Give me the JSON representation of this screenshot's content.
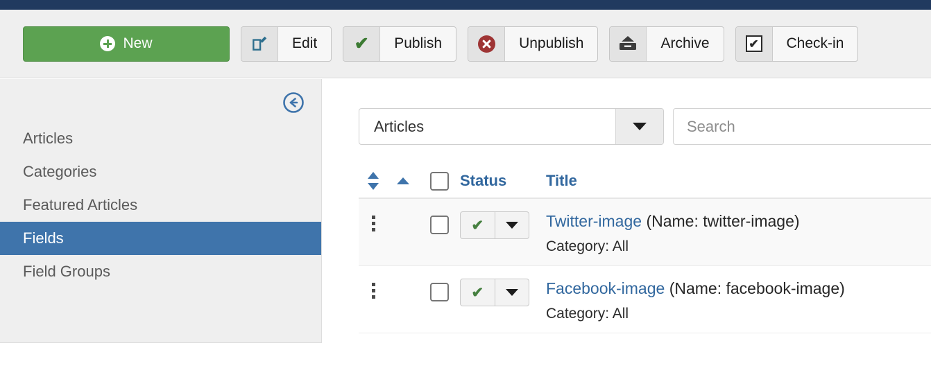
{
  "colors": {
    "topbar": "#213a5f",
    "new_button": "#5ca251",
    "active_menu": "#3f74ab",
    "link": "#31679e",
    "danger": "#9e3434",
    "success": "#468040"
  },
  "toolbar": {
    "buttons": [
      {
        "label": "New",
        "icon": "plus-circle-icon"
      },
      {
        "label": "Edit",
        "icon": "pencil-square-icon"
      },
      {
        "label": "Publish",
        "icon": "check-icon"
      },
      {
        "label": "Unpublish",
        "icon": "x-circle-icon"
      },
      {
        "label": "Archive",
        "icon": "archive-box-icon"
      },
      {
        "label": "Check-in",
        "icon": "checkbox-checked-icon"
      }
    ]
  },
  "sidebar": {
    "collapse_icon": "circle-arrow-left-icon",
    "items": [
      {
        "label": "Articles",
        "active": false
      },
      {
        "label": "Categories",
        "active": false
      },
      {
        "label": "Featured Articles",
        "active": false
      },
      {
        "label": "Fields",
        "active": true
      },
      {
        "label": "Field Groups",
        "active": false
      }
    ]
  },
  "filters": {
    "context_select": {
      "value": "Articles",
      "caret_icon": "chevron-down-icon"
    },
    "search": {
      "value": "",
      "placeholder": "Search"
    }
  },
  "table": {
    "headers": {
      "sort_icon": "sort-updown-icon",
      "ordering_icon": "sort-ascending-icon",
      "select_all": "select-all-checkbox",
      "status": "Status",
      "title": "Title"
    },
    "rows": [
      {
        "grip": "drag-handle-icon",
        "checked": false,
        "status": {
          "icon": "check-icon",
          "caret": "chevron-down-icon"
        },
        "title": "Twitter-image",
        "name": "(Name: twitter-image)",
        "category": "Category: All"
      },
      {
        "grip": "drag-handle-icon",
        "checked": false,
        "status": {
          "icon": "check-icon",
          "caret": "chevron-down-icon"
        },
        "title": "Facebook-image",
        "name": "(Name: facebook-image)",
        "category": "Category: All"
      }
    ]
  }
}
